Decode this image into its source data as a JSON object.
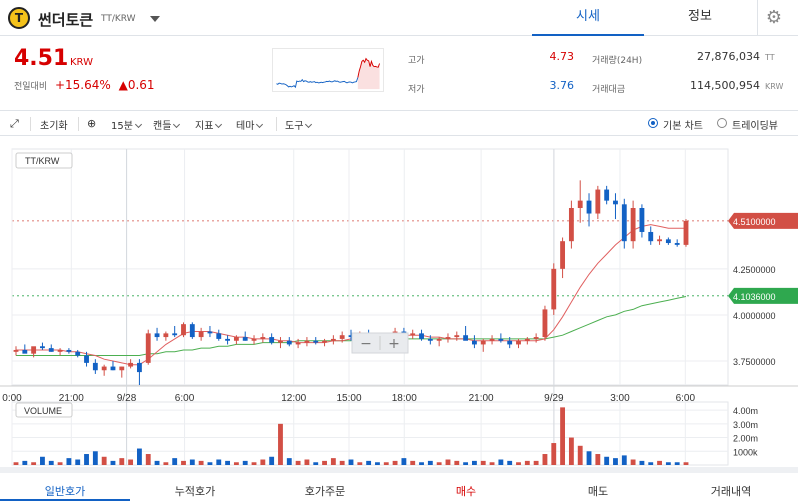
{
  "header": {
    "coin_name": "썬더토큰",
    "pair": "TT/KRW",
    "logo_char": "T",
    "tabs": [
      {
        "label": "시세",
        "active": true
      },
      {
        "label": "정보",
        "active": false
      }
    ],
    "settings_icon": "gear-icon"
  },
  "price": {
    "value": "4.51",
    "unit": "KRW",
    "change_label": "전일대비",
    "change_pct": "+15.64%",
    "change_abs": "▲0.61"
  },
  "stats": {
    "high_label": "고가",
    "high_value": "4.73",
    "low_label": "저가",
    "low_value": "3.76",
    "volume_label": "거래량(24H)",
    "volume_value": "27,876,034",
    "volume_unit": "TT",
    "amount_label": "거래대금",
    "amount_value": "114,500,954",
    "amount_unit": "KRW"
  },
  "toolbar": {
    "reset": "초기화",
    "interval": "15분",
    "candle": "캔들",
    "indicator": "지표",
    "theme": "테마",
    "tools": "도구",
    "basic_chart": "기본 차트",
    "tradingview": "트레이딩뷰"
  },
  "chart_data": {
    "type": "candlestick",
    "symbol_label": "TT/KRW",
    "x_ticks": [
      "0:00",
      "21:00",
      "9/28",
      "6:00",
      "12:00",
      "15:00",
      "18:00",
      "21:00",
      "9/29",
      "3:00",
      "6:00"
    ],
    "y_ticks": [
      "4.2500000",
      "4.0000000",
      "3.7500000"
    ],
    "price_ylim": [
      3.62,
      4.9
    ],
    "last_price_tag": "4.5100000",
    "ma_tag": "4.1036000",
    "volume_label": "VOLUME",
    "volume_ticks": [
      "4.00m",
      "3.00m",
      "2.00m",
      "1000k"
    ],
    "volume_ylim": [
      0,
      4.3
    ],
    "candles": [
      [
        3.8,
        3.83,
        3.78,
        3.81
      ],
      [
        3.81,
        3.84,
        3.8,
        3.79
      ],
      [
        3.79,
        3.82,
        3.77,
        3.83
      ],
      [
        3.83,
        3.85,
        3.81,
        3.82
      ],
      [
        3.82,
        3.84,
        3.8,
        3.8
      ],
      [
        3.8,
        3.82,
        3.78,
        3.81
      ],
      [
        3.81,
        3.82,
        3.79,
        3.8
      ],
      [
        3.8,
        3.81,
        3.77,
        3.78
      ],
      [
        3.78,
        3.8,
        3.72,
        3.74
      ],
      [
        3.74,
        3.76,
        3.68,
        3.7
      ],
      [
        3.7,
        3.73,
        3.67,
        3.72
      ],
      [
        3.72,
        3.75,
        3.7,
        3.7
      ],
      [
        3.7,
        3.72,
        3.66,
        3.72
      ],
      [
        3.72,
        3.76,
        3.71,
        3.74
      ],
      [
        3.74,
        3.76,
        3.62,
        3.69
      ],
      [
        3.74,
        3.92,
        3.73,
        3.9
      ],
      [
        3.9,
        3.93,
        3.86,
        3.88
      ],
      [
        3.88,
        3.91,
        3.86,
        3.9
      ],
      [
        3.9,
        3.94,
        3.88,
        3.89
      ],
      [
        3.89,
        3.96,
        3.88,
        3.95
      ],
      [
        3.95,
        3.96,
        3.87,
        3.88
      ],
      [
        3.88,
        3.93,
        3.86,
        3.91
      ],
      [
        3.91,
        3.94,
        3.88,
        3.9
      ],
      [
        3.9,
        3.92,
        3.86,
        3.87
      ],
      [
        3.87,
        3.89,
        3.84,
        3.86
      ],
      [
        3.86,
        3.89,
        3.84,
        3.88
      ],
      [
        3.88,
        3.91,
        3.86,
        3.86
      ],
      [
        3.86,
        3.89,
        3.84,
        3.87
      ],
      [
        3.87,
        3.9,
        3.85,
        3.88
      ],
      [
        3.88,
        3.9,
        3.84,
        3.85
      ],
      [
        3.85,
        3.88,
        3.82,
        3.86
      ],
      [
        3.86,
        3.88,
        3.83,
        3.84
      ],
      [
        3.84,
        3.87,
        3.82,
        3.85
      ],
      [
        3.85,
        3.88,
        3.83,
        3.86
      ],
      [
        3.86,
        3.88,
        3.84,
        3.85
      ],
      [
        3.85,
        3.87,
        3.83,
        3.86
      ],
      [
        3.86,
        3.89,
        3.84,
        3.87
      ],
      [
        3.87,
        3.91,
        3.85,
        3.89
      ],
      [
        3.89,
        3.92,
        3.86,
        3.88
      ],
      [
        3.88,
        3.91,
        3.86,
        3.9
      ],
      [
        3.9,
        3.92,
        3.87,
        3.88
      ],
      [
        3.88,
        3.9,
        3.85,
        3.87
      ],
      [
        3.87,
        3.9,
        3.85,
        3.89
      ],
      [
        3.89,
        3.93,
        3.87,
        3.91
      ],
      [
        3.91,
        3.93,
        3.88,
        3.89
      ],
      [
        3.89,
        3.92,
        3.87,
        3.9
      ],
      [
        3.9,
        3.92,
        3.86,
        3.87
      ],
      [
        3.87,
        3.89,
        3.84,
        3.86
      ],
      [
        3.86,
        3.88,
        3.83,
        3.87
      ],
      [
        3.87,
        3.9,
        3.85,
        3.88
      ],
      [
        3.88,
        3.91,
        3.86,
        3.89
      ],
      [
        3.89,
        3.94,
        3.87,
        3.86
      ],
      [
        3.86,
        3.89,
        3.82,
        3.84
      ],
      [
        3.84,
        3.87,
        3.8,
        3.86
      ],
      [
        3.86,
        3.89,
        3.84,
        3.87
      ],
      [
        3.87,
        3.9,
        3.85,
        3.86
      ],
      [
        3.86,
        3.88,
        3.82,
        3.84
      ],
      [
        3.84,
        3.87,
        3.82,
        3.86
      ],
      [
        3.86,
        3.88,
        3.84,
        3.87
      ],
      [
        3.87,
        3.9,
        3.85,
        3.88
      ],
      [
        3.88,
        4.05,
        3.86,
        4.03
      ],
      [
        4.03,
        4.28,
        4.0,
        4.25
      ],
      [
        4.25,
        4.42,
        4.2,
        4.4
      ],
      [
        4.4,
        4.62,
        4.36,
        4.58
      ],
      [
        4.58,
        4.73,
        4.5,
        4.62
      ],
      [
        4.62,
        4.66,
        4.48,
        4.55
      ],
      [
        4.55,
        4.7,
        4.52,
        4.68
      ],
      [
        4.68,
        4.7,
        4.6,
        4.62
      ],
      [
        4.62,
        4.66,
        4.52,
        4.6
      ],
      [
        4.6,
        4.63,
        4.36,
        4.4
      ],
      [
        4.4,
        4.62,
        4.36,
        4.58
      ],
      [
        4.58,
        4.6,
        4.42,
        4.45
      ],
      [
        4.45,
        4.48,
        4.38,
        4.4
      ],
      [
        4.4,
        4.43,
        4.38,
        4.41
      ],
      [
        4.41,
        4.42,
        4.38,
        4.39
      ],
      [
        4.39,
        4.41,
        4.37,
        4.38
      ],
      [
        4.38,
        4.52,
        4.37,
        4.51
      ]
    ],
    "volumes": [
      0.2,
      0.3,
      0.2,
      0.6,
      0.3,
      0.2,
      0.5,
      0.4,
      0.8,
      1.0,
      0.6,
      0.3,
      0.5,
      0.4,
      1.2,
      0.8,
      0.3,
      0.2,
      0.5,
      0.3,
      0.4,
      0.3,
      0.2,
      0.4,
      0.3,
      0.2,
      0.3,
      0.2,
      0.4,
      0.6,
      3.0,
      0.5,
      0.3,
      0.4,
      0.2,
      0.3,
      0.5,
      0.3,
      0.4,
      0.2,
      0.3,
      0.2,
      0.2,
      0.3,
      0.5,
      0.3,
      0.2,
      0.3,
      0.2,
      0.4,
      0.3,
      0.2,
      0.3,
      0.3,
      0.2,
      0.4,
      0.3,
      0.2,
      0.3,
      0.3,
      0.8,
      1.6,
      4.2,
      2.0,
      1.4,
      1.0,
      0.8,
      0.6,
      0.5,
      0.7,
      0.4,
      0.3,
      0.2,
      0.3,
      0.2,
      0.2,
      0.2
    ],
    "ma_short": [
      3.81,
      3.81,
      3.81,
      3.81,
      3.81,
      3.81,
      3.8,
      3.8,
      3.79,
      3.78,
      3.76,
      3.75,
      3.74,
      3.73,
      3.73,
      3.76,
      3.8,
      3.84,
      3.87,
      3.9,
      3.91,
      3.91,
      3.91,
      3.9,
      3.89,
      3.88,
      3.88,
      3.87,
      3.87,
      3.87,
      3.86,
      3.86,
      3.85,
      3.85,
      3.85,
      3.85,
      3.86,
      3.86,
      3.87,
      3.87,
      3.88,
      3.88,
      3.88,
      3.89,
      3.89,
      3.89,
      3.89,
      3.88,
      3.88,
      3.87,
      3.87,
      3.87,
      3.86,
      3.86,
      3.86,
      3.86,
      3.86,
      3.86,
      3.86,
      3.86,
      3.87,
      3.92,
      3.99,
      4.07,
      4.15,
      4.22,
      4.28,
      4.33,
      4.38,
      4.42,
      4.46,
      4.48,
      4.49,
      4.48,
      4.47,
      4.47,
      4.47
    ],
    "ma_long": [
      3.78,
      3.78,
      3.78,
      3.78,
      3.78,
      3.78,
      3.78,
      3.78,
      3.78,
      3.78,
      3.78,
      3.78,
      3.78,
      3.78,
      3.78,
      3.79,
      3.79,
      3.8,
      3.8,
      3.81,
      3.81,
      3.82,
      3.82,
      3.83,
      3.83,
      3.84,
      3.84,
      3.84,
      3.85,
      3.85,
      3.85,
      3.85,
      3.86,
      3.86,
      3.86,
      3.86,
      3.86,
      3.86,
      3.86,
      3.87,
      3.87,
      3.87,
      3.87,
      3.87,
      3.87,
      3.87,
      3.87,
      3.87,
      3.87,
      3.87,
      3.87,
      3.87,
      3.87,
      3.87,
      3.87,
      3.87,
      3.87,
      3.87,
      3.87,
      3.87,
      3.87,
      3.88,
      3.89,
      3.91,
      3.93,
      3.95,
      3.97,
      3.99,
      4.0,
      4.02,
      4.03,
      4.05,
      4.06,
      4.07,
      4.08,
      4.09,
      4.1
    ]
  },
  "bottom_tabs": [
    "일반호가",
    "누적호가",
    "호가주문",
    "매수",
    "매도",
    "거래내역"
  ],
  "colors": {
    "up": "#d24f45",
    "down": "#1261c4",
    "ma_short": "#e06060",
    "ma_long": "#4caf50",
    "accent": "#1261c4",
    "price_red": "#d60000",
    "ma_tag_bg": "#2fa84f",
    "price_tag_bg": "#d24f45"
  }
}
